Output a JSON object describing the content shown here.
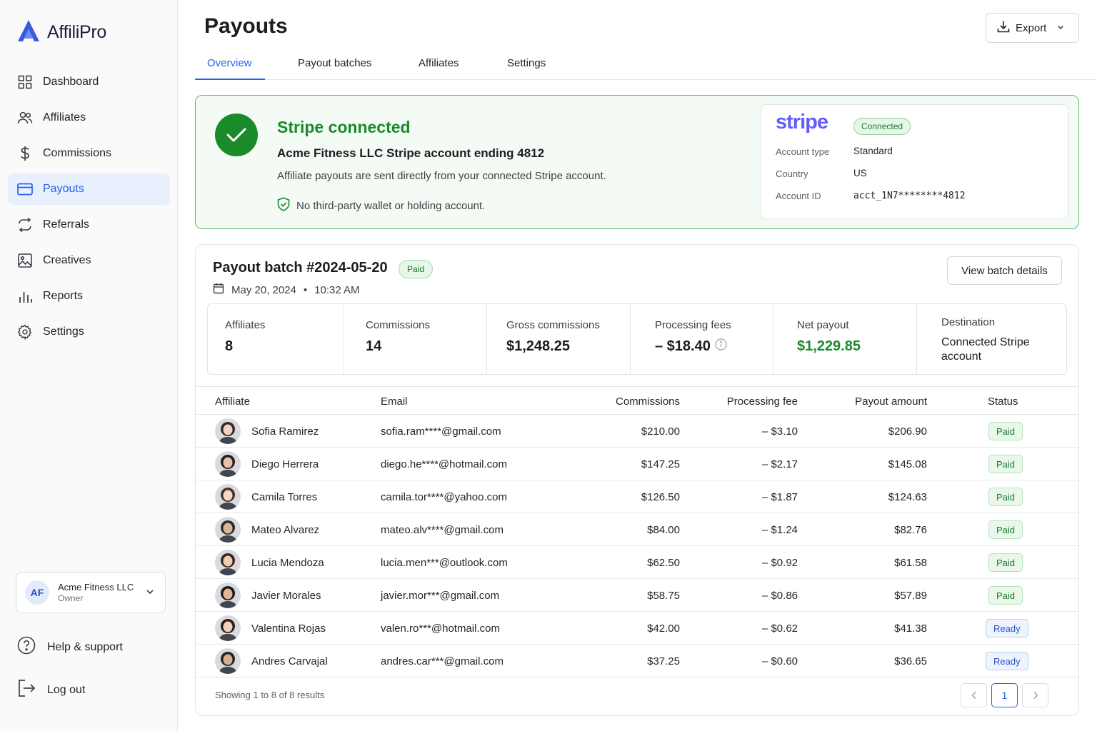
{
  "brand": {
    "name": "AffiliPro"
  },
  "nav": {
    "items": [
      {
        "label": "Dashboard",
        "icon": "grid-icon"
      },
      {
        "label": "Affiliates",
        "icon": "users-icon"
      },
      {
        "label": "Commissions",
        "icon": "dollar-icon"
      },
      {
        "label": "Payouts",
        "icon": "card-icon",
        "active": true
      },
      {
        "label": "Referrals",
        "icon": "arrows-icon"
      },
      {
        "label": "Creatives",
        "icon": "image-icon"
      },
      {
        "label": "Reports",
        "icon": "bar-chart-icon"
      },
      {
        "label": "Settings",
        "icon": "gear-icon"
      }
    ]
  },
  "account": {
    "initials": "AF",
    "name": "Acme Fitness LLC",
    "role": "Owner"
  },
  "side_links": {
    "help": "Help & support",
    "logout": "Log out"
  },
  "header": {
    "title": "Payouts",
    "export_label": "Export"
  },
  "tabs": [
    {
      "label": "Overview",
      "active": true
    },
    {
      "label": "Payout batches"
    },
    {
      "label": "Affiliates"
    },
    {
      "label": "Settings"
    }
  ],
  "stripe": {
    "title": "Stripe connected",
    "subtitle": "Acme Fitness LLC Stripe account ending 4812",
    "description": "Affiliate payouts are sent directly from your connected Stripe account.",
    "note": "No third-party wallet or holding account.",
    "logo_text": "stripe",
    "status": "Connected",
    "account_type_label": "Account type",
    "account_type": "Standard",
    "country_label": "Country",
    "country": "US",
    "account_id_label": "Account ID",
    "account_id": "acct_1N7********4812"
  },
  "batch": {
    "title": "Payout batch #2024-05-20",
    "status": "Paid",
    "date": "May 20, 2024",
    "separator": "•",
    "time": "10:32 AM",
    "view_label": "View batch details",
    "stats": {
      "affiliates_label": "Affiliates",
      "affiliates": "8",
      "commissions_label": "Commissions",
      "commissions": "14",
      "gross_label": "Gross commissions",
      "gross": "$1,248.25",
      "fees_label": "Processing fees",
      "fees": "– $18.40",
      "net_label": "Net payout",
      "net": "$1,229.85",
      "destination_label": "Destination",
      "destination": "Connected Stripe account"
    }
  },
  "table": {
    "headers": {
      "affiliate": "Affiliate",
      "email": "Email",
      "commissions": "Commissions",
      "fee": "Processing fee",
      "payout": "Payout amount",
      "status": "Status"
    },
    "rows": [
      {
        "name": "Sofia Ramirez",
        "email": "sofia.ram****@gmail.com",
        "commissions": "$210.00",
        "fee": "– $3.10",
        "payout": "$206.90",
        "status": "Paid"
      },
      {
        "name": "Diego Herrera",
        "email": "diego.he****@hotmail.com",
        "commissions": "$147.25",
        "fee": "– $2.17",
        "payout": "$145.08",
        "status": "Paid"
      },
      {
        "name": "Camila Torres",
        "email": "camila.tor****@yahoo.com",
        "commissions": "$126.50",
        "fee": "– $1.87",
        "payout": "$124.63",
        "status": "Paid"
      },
      {
        "name": "Mateo Alvarez",
        "email": "mateo.alv****@gmail.com",
        "commissions": "$84.00",
        "fee": "– $1.24",
        "payout": "$82.76",
        "status": "Paid"
      },
      {
        "name": "Lucia Mendoza",
        "email": "lucia.men***@outlook.com",
        "commissions": "$62.50",
        "fee": "– $0.92",
        "payout": "$61.58",
        "status": "Paid"
      },
      {
        "name": "Javier Morales",
        "email": "javier.mor***@gmail.com",
        "commissions": "$58.75",
        "fee": "– $0.86",
        "payout": "$57.89",
        "status": "Paid"
      },
      {
        "name": "Valentina Rojas",
        "email": "valen.ro***@hotmail.com",
        "commissions": "$42.00",
        "fee": "– $0.62",
        "payout": "$41.38",
        "status": "Ready"
      },
      {
        "name": "Andres Carvajal",
        "email": "andres.car***@gmail.com",
        "commissions": "$37.25",
        "fee": "– $0.60",
        "payout": "$36.65",
        "status": "Ready"
      }
    ],
    "footer": "Showing 1 to 8 of 8 results",
    "current_page": "1"
  },
  "colors": {
    "accent": "#2563eb",
    "success": "#1a8a2b",
    "stripe_brand": "#635bff"
  }
}
